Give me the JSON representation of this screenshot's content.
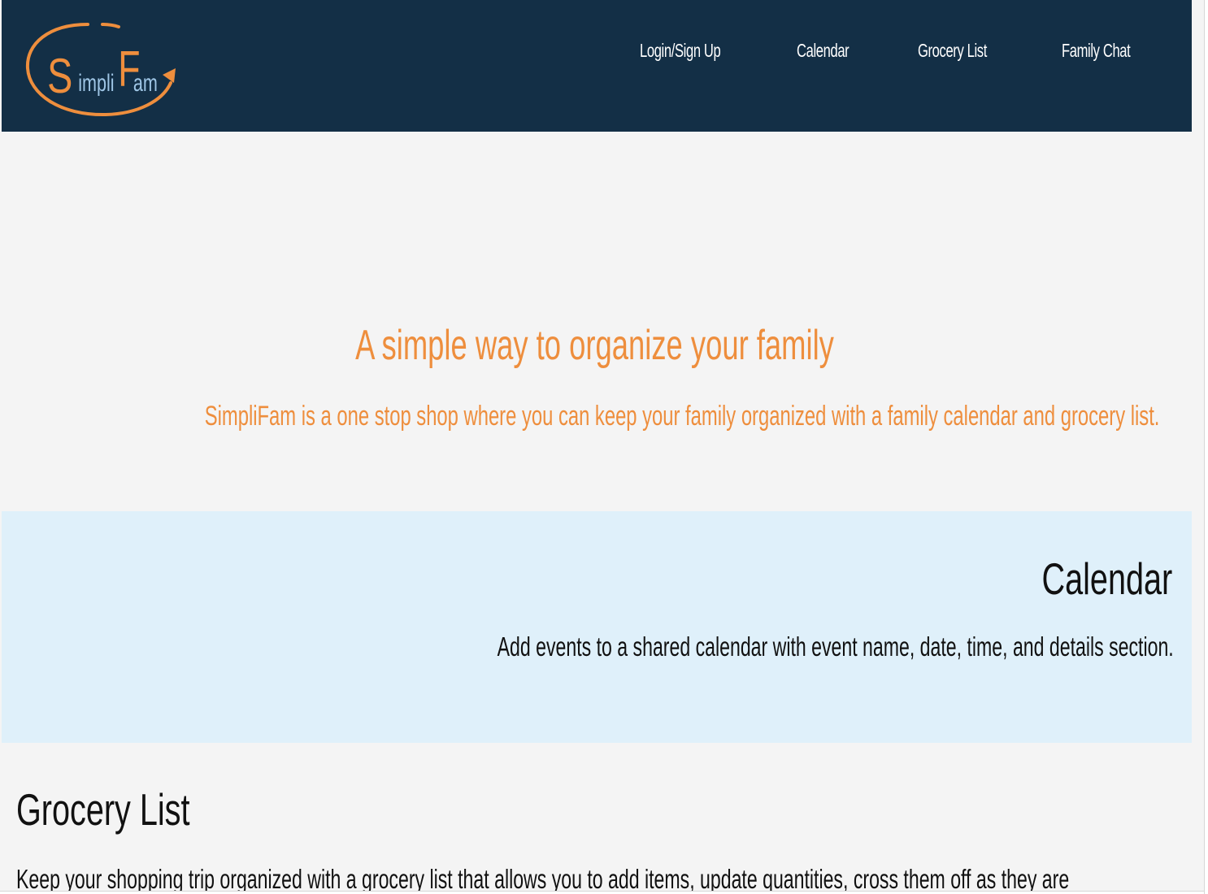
{
  "nav": {
    "logo_alt": "SimpliFam",
    "links": [
      "Login/Sign Up",
      "Calendar",
      "Grocery List",
      "Family Chat"
    ]
  },
  "hero": {
    "title": "A simple way to organize your family",
    "subtitle": "SimpliFam is a one stop shop where you can keep your family organized with a family calendar and grocery list."
  },
  "calendar_section": {
    "heading": "Calendar",
    "description": "Add events to a shared calendar with event name, date, time, and details section."
  },
  "grocery_section": {
    "heading": "Grocery List",
    "description": "Keep your shopping trip organized with a grocery list that allows you to add items, update quantities, cross them off as they are"
  },
  "colors": {
    "navbar": "#132f46",
    "accent_orange": "#ee8e3d",
    "logo_blue": "#9fc6e6",
    "calendar_bg": "#dff0fa",
    "page_bg": "#f4f4f4"
  }
}
